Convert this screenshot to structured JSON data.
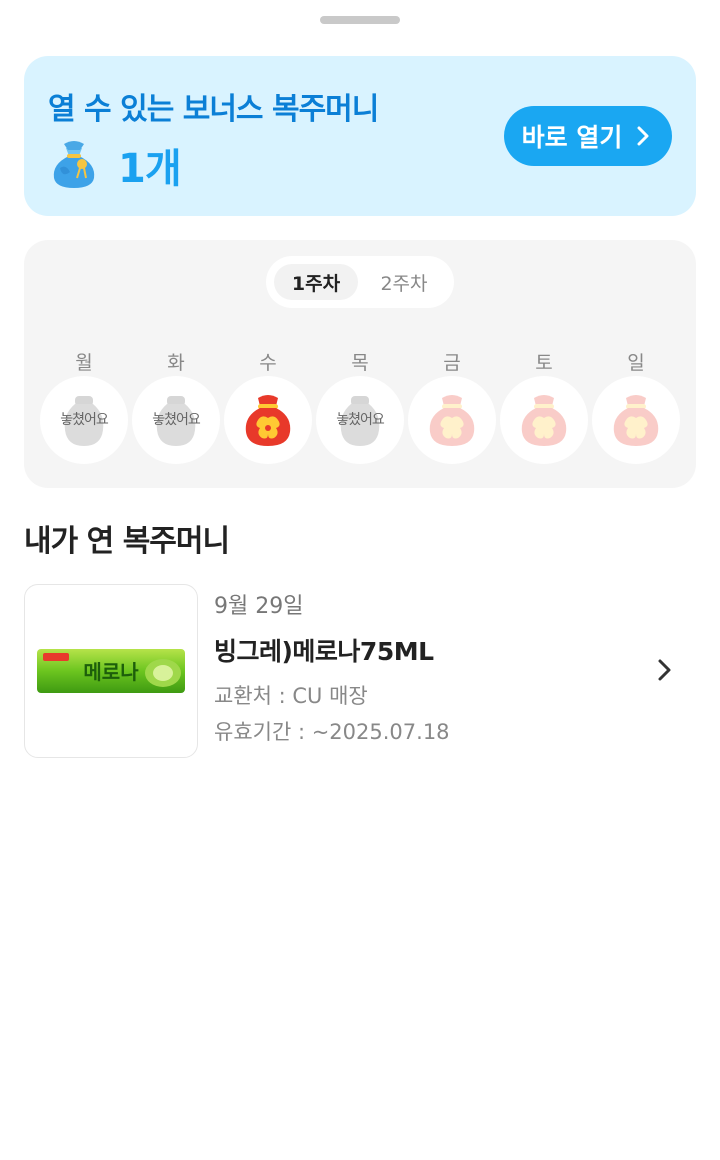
{
  "bonus": {
    "title": "열 수 있는 보너스 복주머니",
    "count": "1개",
    "open_label": "바로 열기",
    "icons": [
      "money-bag-icon",
      "chevron-right-icon"
    ]
  },
  "attendance": {
    "weeks": [
      {
        "label": "1주차",
        "selected": true
      },
      {
        "label": "2주차",
        "selected": false
      }
    ],
    "days": [
      {
        "label": "월",
        "state": "missed",
        "text": "놓쳤어요"
      },
      {
        "label": "화",
        "state": "missed",
        "text": "놓쳤어요"
      },
      {
        "label": "수",
        "state": "opened",
        "text": ""
      },
      {
        "label": "목",
        "state": "missed",
        "text": "놓쳤어요"
      },
      {
        "label": "금",
        "state": "upcoming",
        "text": ""
      },
      {
        "label": "토",
        "state": "upcoming",
        "text": ""
      },
      {
        "label": "일",
        "state": "upcoming",
        "text": ""
      }
    ]
  },
  "opened": {
    "title": "내가 연 복주머니",
    "items": [
      {
        "date": "9월 29일",
        "name": "빙그레)메로나75ML",
        "store": "교환처 : CU 매장",
        "expiry": "유효기간 : ~2025.07.18",
        "thumbnail_text": "메로나"
      }
    ]
  },
  "colors": {
    "accent": "#1aa7f2",
    "banner_bg": "#d9f3ff",
    "pouch_red": "#e8392a",
    "pouch_gold": "#ffc933"
  }
}
